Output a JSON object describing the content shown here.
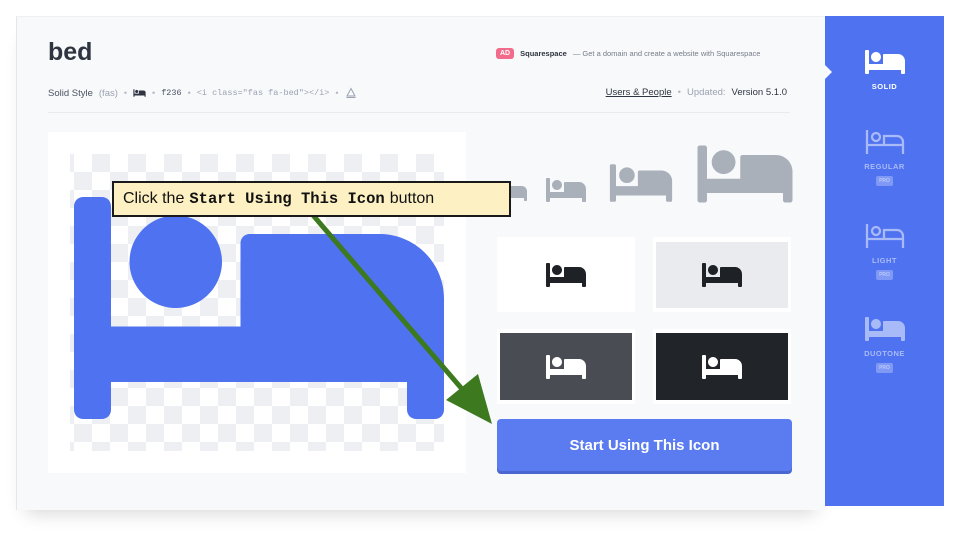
{
  "icon": {
    "name": "bed",
    "style_label": "Solid Style",
    "style_prefix": "(fas)",
    "unicode": "f236",
    "html_snippet": "<i class=\"fas fa-bed\"></i>"
  },
  "ad": {
    "badge": "AD",
    "brand": "Squarespace",
    "text": "— Get a domain and create a website with Squarespace"
  },
  "meta_right": {
    "category": "Users & People",
    "updated_label": "Updated:",
    "version": "Version 5.1.0"
  },
  "sidebar": {
    "styles": [
      {
        "label": "SOLID",
        "pro": ""
      },
      {
        "label": "REGULAR",
        "pro": "PRO"
      },
      {
        "label": "LIGHT",
        "pro": "PRO"
      },
      {
        "label": "DUOTONE",
        "pro": "PRO"
      }
    ]
  },
  "start_button": {
    "label": "Start Using This Icon"
  },
  "callout": {
    "prefix": "Click the",
    "code": "Start Using This Icon",
    "suffix": "button"
  },
  "colors": {
    "accent": "#4f72f0",
    "button": "#5b7bf0",
    "icon_preview": "#4f72f0",
    "icon_gray": "#aab0ba",
    "arrow": "#3d7a1f",
    "callout_bg": "#fdf0c2"
  },
  "icons": {
    "bed_meta": "bed-icon",
    "copy": "copy-icon"
  }
}
